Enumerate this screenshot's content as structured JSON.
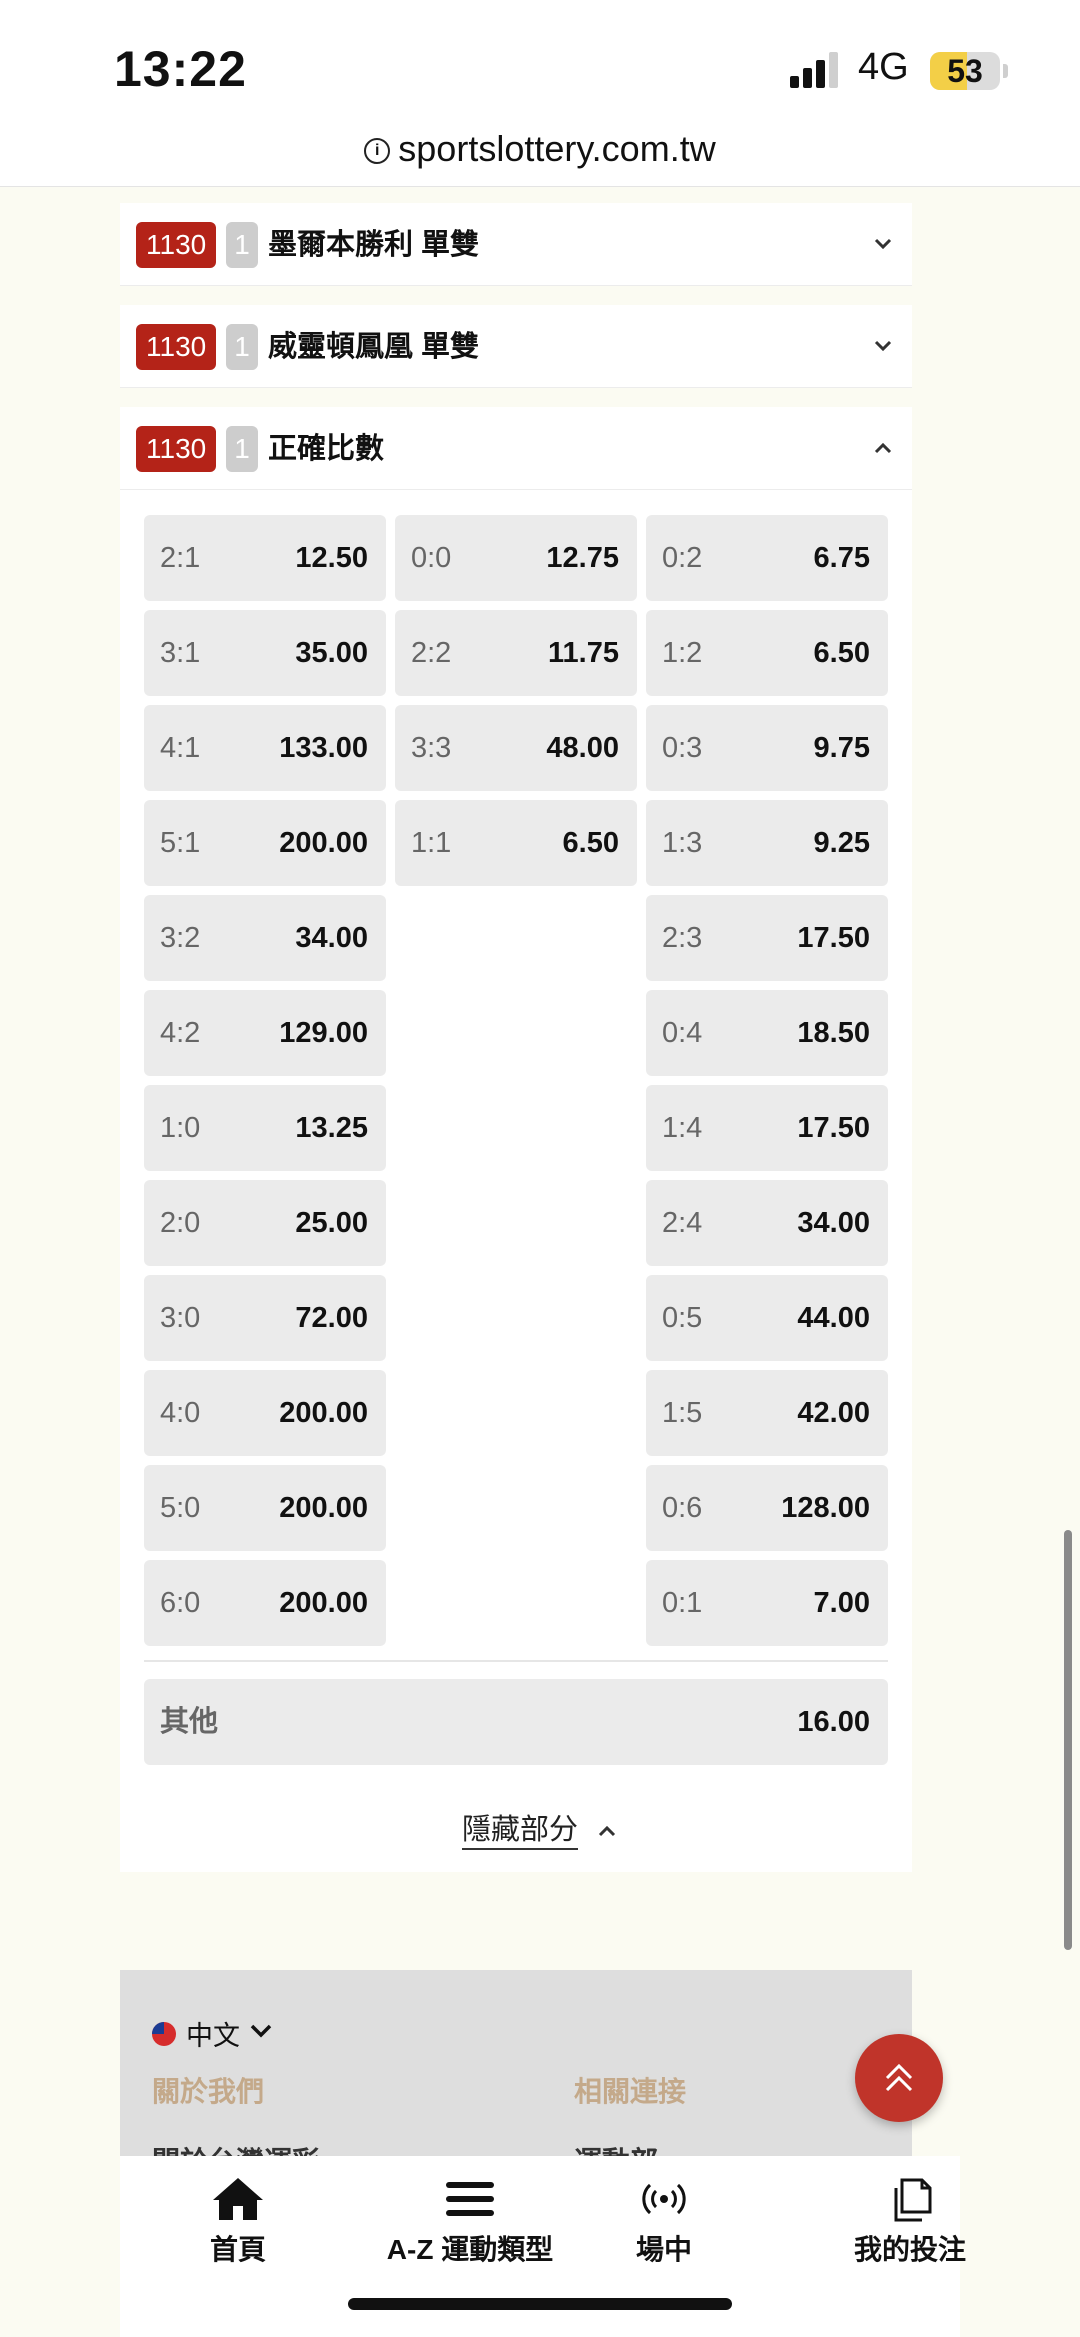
{
  "status_bar": {
    "time": "13:22",
    "network": "4G",
    "battery": "53",
    "battery_level": 0.53
  },
  "browser": {
    "url": "sportslottery.com.tw"
  },
  "markets": [
    {
      "code": "1130",
      "num": "1",
      "name": "墨爾本勝利 單雙",
      "expanded": false
    },
    {
      "code": "1130",
      "num": "1",
      "name": "威靈頓鳳凰 單雙",
      "expanded": false
    },
    {
      "code": "1130",
      "num": "1",
      "name": "正確比數",
      "expanded": true
    }
  ],
  "correct_score": {
    "home": [
      {
        "score": "2:1",
        "odds": "12.50"
      },
      {
        "score": "3:1",
        "odds": "35.00"
      },
      {
        "score": "4:1",
        "odds": "133.00"
      },
      {
        "score": "5:1",
        "odds": "200.00"
      },
      {
        "score": "3:2",
        "odds": "34.00"
      },
      {
        "score": "4:2",
        "odds": "129.00"
      },
      {
        "score": "1:0",
        "odds": "13.25"
      },
      {
        "score": "2:0",
        "odds": "25.00"
      },
      {
        "score": "3:0",
        "odds": "72.00"
      },
      {
        "score": "4:0",
        "odds": "200.00"
      },
      {
        "score": "5:0",
        "odds": "200.00"
      },
      {
        "score": "6:0",
        "odds": "200.00"
      }
    ],
    "draw": [
      {
        "score": "0:0",
        "odds": "12.75"
      },
      {
        "score": "2:2",
        "odds": "11.75"
      },
      {
        "score": "3:3",
        "odds": "48.00"
      },
      {
        "score": "1:1",
        "odds": "6.50"
      }
    ],
    "away": [
      {
        "score": "0:2",
        "odds": "6.75"
      },
      {
        "score": "1:2",
        "odds": "6.50"
      },
      {
        "score": "0:3",
        "odds": "9.75"
      },
      {
        "score": "1:3",
        "odds": "9.25"
      },
      {
        "score": "2:3",
        "odds": "17.50"
      },
      {
        "score": "0:4",
        "odds": "18.50"
      },
      {
        "score": "1:4",
        "odds": "17.50"
      },
      {
        "score": "2:4",
        "odds": "34.00"
      },
      {
        "score": "0:5",
        "odds": "44.00"
      },
      {
        "score": "1:5",
        "odds": "42.00"
      },
      {
        "score": "0:6",
        "odds": "128.00"
      },
      {
        "score": "0:1",
        "odds": "7.00"
      }
    ],
    "other": {
      "label": "其他",
      "odds": "16.00"
    },
    "hide_label": "隱藏部分"
  },
  "footer": {
    "language": "中文",
    "about": "關於我們",
    "links": "相關連接",
    "about_item_cut": "關於台灣運彩",
    "links_item_cut": "運動部"
  },
  "bottom_nav": [
    {
      "label": "首頁",
      "icon": "home-icon"
    },
    {
      "label": "A-Z 運動類型",
      "icon": "menu-icon"
    },
    {
      "label": "場中",
      "icon": "live-broadcast-icon"
    },
    {
      "label": "我的投注",
      "icon": "betslip-icon"
    }
  ],
  "colors": {
    "brand_red": "#b42318",
    "fab_red": "#c0342a",
    "cell_bg": "#ebebeb",
    "page_bg": "#fbfbf2"
  }
}
